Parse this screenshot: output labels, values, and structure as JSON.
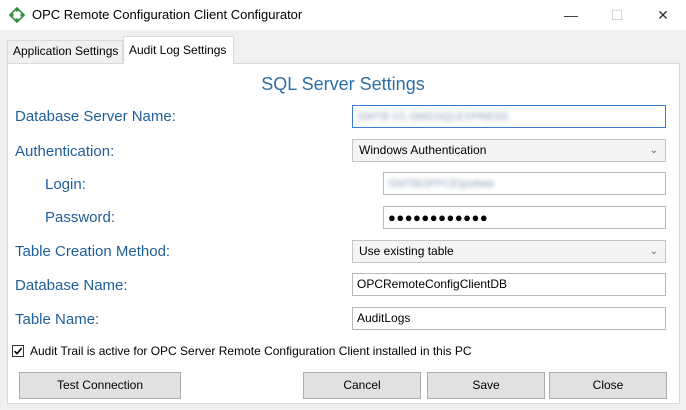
{
  "window": {
    "title": "OPC Remote Configuration Client Configurator",
    "controls": {
      "minimize": "—",
      "maximize": "☐",
      "close": "✕"
    }
  },
  "tabs": [
    {
      "label": "Application Settings",
      "active": false
    },
    {
      "label": "Audit Log Settings",
      "active": true
    }
  ],
  "section": {
    "title": "SQL Server Settings"
  },
  "form": {
    "server_name_label": "Database Server Name:",
    "server_name_value": "SWTB-V1-SMGSQLEXPRESS",
    "authentication_label": "Authentication:",
    "authentication_value": "Windows Authentication",
    "login_label": "Login:",
    "login_value": "SWTBOPPCE\\joebee",
    "password_label": "Password:",
    "password_value": "●●●●●●●●●●●●",
    "table_method_label": "Table Creation Method:",
    "table_method_value": "Use existing table",
    "database_name_label": "Database Name:",
    "database_name_value": "OPCRemoteConfigClientDB",
    "table_name_label": "Table Name:",
    "table_name_value": "AuditLogs"
  },
  "audit_trail": {
    "checked": true,
    "label": "Audit Trail is active for OPC Server Remote Configuration Client installed in this PC"
  },
  "buttons": {
    "test_connection": "Test Connection",
    "cancel": "Cancel",
    "save": "Save",
    "close": "Close"
  },
  "colors": {
    "label_blue": "#1e5f9a",
    "title_blue": "#2e6fa4",
    "focus_border": "#3b7bd4",
    "icon_green": "#2f8f3a"
  },
  "icons": {
    "app": "diamond-network-icon",
    "dropdown": "chevron-down-icon",
    "check": "checkmark-icon"
  }
}
